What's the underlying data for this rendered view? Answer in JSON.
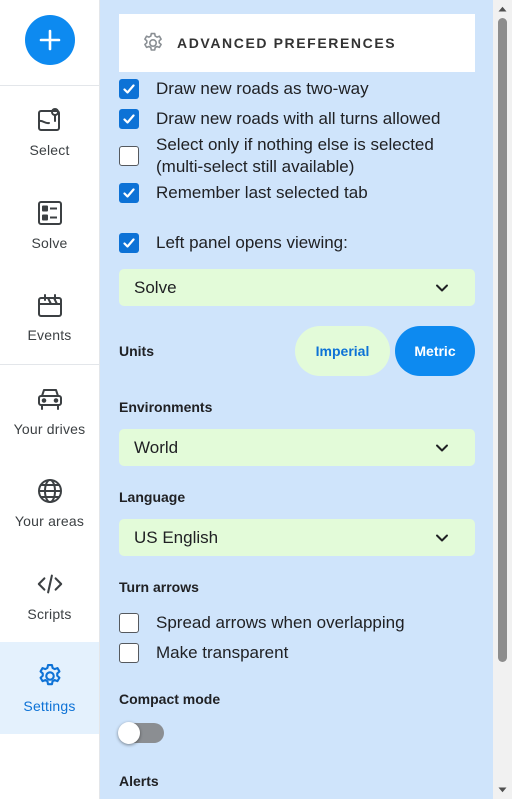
{
  "nav": {
    "add_button_icon": "plus-icon",
    "items": [
      {
        "label": "Select",
        "icon": "select-map-icon"
      },
      {
        "label": "Solve",
        "icon": "checklist-icon"
      },
      {
        "label": "Events",
        "icon": "calendar-icon"
      },
      {
        "label": "Your drives",
        "icon": "car-icon"
      },
      {
        "label": "Your areas",
        "icon": "globe-icon"
      },
      {
        "label": "Scripts",
        "icon": "code-icon"
      },
      {
        "label": "Settings",
        "icon": "gear-icon",
        "active": true
      }
    ]
  },
  "panel": {
    "title": "ADVANCED PREFERENCES",
    "options": [
      {
        "label": "Draw new roads as two-way",
        "checked": true
      },
      {
        "label": "Draw new roads with all turns allowed",
        "checked": true
      },
      {
        "label": "Select only if nothing else is selected (multi-select still available)",
        "checked": false
      },
      {
        "label": "Remember last selected tab",
        "checked": true
      },
      {
        "label": "Left panel opens viewing:",
        "checked": true
      }
    ],
    "left_panel_select": "Solve",
    "units": {
      "label": "Units",
      "imperial": "Imperial",
      "metric": "Metric",
      "selected": "Metric"
    },
    "environments": {
      "label": "Environments",
      "value": "World"
    },
    "language": {
      "label": "Language",
      "value": "US English"
    },
    "turn_arrows": {
      "label": "Turn arrows",
      "options": [
        {
          "label": "Spread arrows when overlapping",
          "checked": false
        },
        {
          "label": "Make transparent",
          "checked": false
        }
      ]
    },
    "compact_mode": {
      "label": "Compact mode",
      "enabled": false
    },
    "alerts": {
      "label": "Alerts"
    }
  },
  "colors": {
    "accent": "#0d8af0",
    "panel_bg": "#cfe4fb",
    "select_bg": "#e3fbd9",
    "active_nav": "#0d72d6"
  }
}
